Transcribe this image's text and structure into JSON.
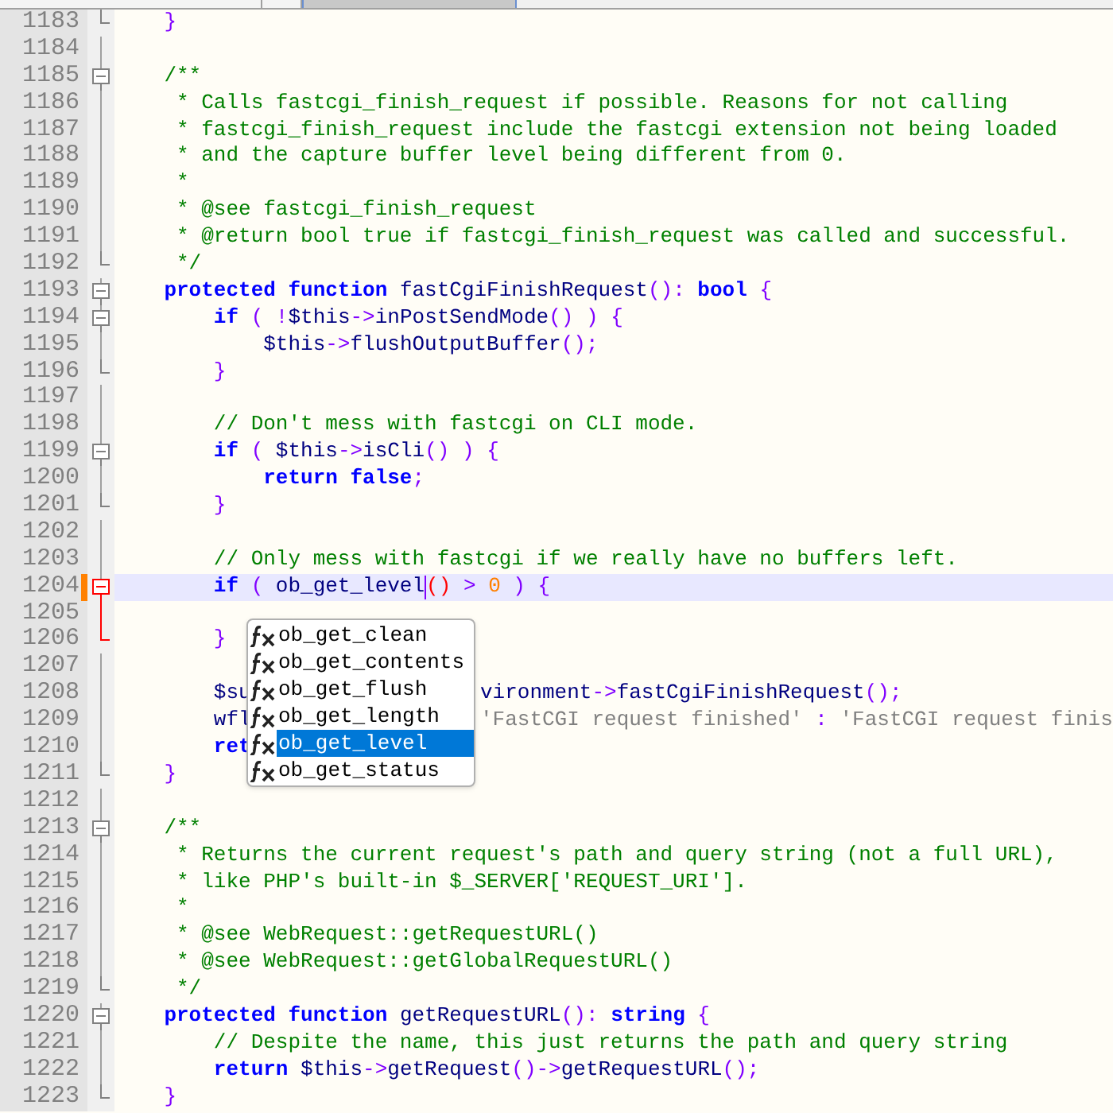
{
  "tabs": [
    {
      "selected": false
    },
    {
      "selected": false
    },
    {
      "selected": true
    }
  ],
  "editor": {
    "lines": [
      {
        "number": "1183",
        "kind": "end",
        "tokens": [
          {
            "kind": "op",
            "text": "    }"
          }
        ]
      },
      {
        "number": "1184",
        "kind": "line"
      },
      {
        "number": "1185",
        "kind": "box",
        "tokens": [
          {
            "kind": "cm",
            "text": "    /**"
          }
        ]
      },
      {
        "number": "1186",
        "kind": "line",
        "tokens": [
          {
            "kind": "cm",
            "text": "     * Calls fastcgi_finish_request if possible. Reasons for not calling"
          }
        ]
      },
      {
        "number": "1187",
        "kind": "line",
        "tokens": [
          {
            "kind": "cm",
            "text": "     * fastcgi_finish_request include the fastcgi extension not being loaded"
          }
        ]
      },
      {
        "number": "1188",
        "kind": "line",
        "tokens": [
          {
            "kind": "cm",
            "text": "     * and the capture buffer level being different from 0."
          }
        ]
      },
      {
        "number": "1189",
        "kind": "line",
        "tokens": [
          {
            "kind": "cm",
            "text": "     *"
          }
        ]
      },
      {
        "number": "1190",
        "kind": "line",
        "tokens": [
          {
            "kind": "cm",
            "text": "     * @see fastcgi_finish_request"
          }
        ]
      },
      {
        "number": "1191",
        "kind": "line",
        "tokens": [
          {
            "kind": "cm",
            "text": "     * @return bool true if fastcgi_finish_request was called and successful."
          }
        ]
      },
      {
        "number": "1192",
        "kind": "end",
        "tokens": [
          {
            "kind": "cm",
            "text": "     */"
          }
        ]
      },
      {
        "number": "1193",
        "kind": "box",
        "tokens": [
          {
            "kind": "kw",
            "text": "    protected"
          },
          {
            "kind": "kw",
            "text": " function"
          },
          {
            "kind": "id",
            "text": " fastCgiFinishRequest"
          },
          {
            "kind": "op",
            "text": "():"
          },
          {
            "kind": "kw",
            "text": " bool"
          },
          {
            "kind": "op",
            "text": " {"
          }
        ]
      },
      {
        "number": "1194",
        "kind": "box",
        "tokens": [
          {
            "kind": "kw",
            "text": "        if"
          },
          {
            "kind": "op",
            "text": " ( !"
          },
          {
            "kind": "id",
            "text": "$this"
          },
          {
            "kind": "op",
            "text": "->"
          },
          {
            "kind": "id",
            "text": "inPostSendMode"
          },
          {
            "kind": "op",
            "text": "() ) {"
          }
        ]
      },
      {
        "number": "1195",
        "kind": "line",
        "tokens": [
          {
            "kind": "id",
            "text": "            $this"
          },
          {
            "kind": "op",
            "text": "->"
          },
          {
            "kind": "id",
            "text": "flushOutputBuffer"
          },
          {
            "kind": "op",
            "text": "();"
          }
        ]
      },
      {
        "number": "1196",
        "kind": "end",
        "tokens": [
          {
            "kind": "op",
            "text": "        }"
          }
        ]
      },
      {
        "number": "1197",
        "kind": "line"
      },
      {
        "number": "1198",
        "kind": "line",
        "tokens": [
          {
            "kind": "cm",
            "text": "        // Don't mess with fastcgi on CLI mode."
          }
        ]
      },
      {
        "number": "1199",
        "kind": "box",
        "tokens": [
          {
            "kind": "kw",
            "text": "        if"
          },
          {
            "kind": "op",
            "text": " ( "
          },
          {
            "kind": "id",
            "text": "$this"
          },
          {
            "kind": "op",
            "text": "->"
          },
          {
            "kind": "id",
            "text": "isCli"
          },
          {
            "kind": "op",
            "text": "() ) {"
          }
        ]
      },
      {
        "number": "1200",
        "kind": "line",
        "tokens": [
          {
            "kind": "kw",
            "text": "            return false"
          },
          {
            "kind": "op",
            "text": ";"
          }
        ]
      },
      {
        "number": "1201",
        "kind": "end",
        "tokens": [
          {
            "kind": "op",
            "text": "        }"
          }
        ]
      },
      {
        "number": "1202",
        "kind": "line"
      },
      {
        "number": "1203",
        "kind": "line",
        "tokens": [
          {
            "kind": "cm",
            "text": "        // Only mess with fastcgi if we really have no buffers left."
          }
        ]
      },
      {
        "number": "1204",
        "kind": "box",
        "active": true,
        "current": true,
        "changed": true,
        "tokens": [
          {
            "kind": "kw",
            "text": "        if"
          },
          {
            "kind": "op",
            "text": " ( "
          },
          {
            "kind": "id",
            "text": "ob_get_level",
            "caret": true
          },
          {
            "kind": "match",
            "text": "()"
          },
          {
            "kind": "op",
            "text": " > "
          },
          {
            "kind": "num",
            "text": "0"
          },
          {
            "kind": "op",
            "text": " ) {"
          }
        ]
      },
      {
        "number": "1205",
        "kind": "line",
        "active": true
      },
      {
        "number": "1206",
        "kind": "end",
        "active": true,
        "tokens": [
          {
            "kind": "op",
            "text": "        }"
          }
        ]
      },
      {
        "number": "1207",
        "kind": "line"
      },
      {
        "number": "1208",
        "kind": "line",
        "tokens": [
          {
            "kind": "id",
            "text": "        $su"
          }
        ],
        "tokens_right": [
          {
            "kind": "id",
            "text": "vironment"
          },
          {
            "kind": "op",
            "text": "->"
          },
          {
            "kind": "id",
            "text": "fastCgiFinishRequest"
          },
          {
            "kind": "op",
            "text": "();"
          }
        ]
      },
      {
        "number": "1209",
        "kind": "line",
        "tokens": [
          {
            "kind": "id",
            "text": "        wfl"
          }
        ],
        "tokens_right": [
          {
            "kind": "str",
            "text": "'FastCGI request finished'"
          },
          {
            "kind": "op",
            "text": " : "
          },
          {
            "kind": "str",
            "text": "'FastCGI request finis"
          }
        ]
      },
      {
        "number": "1210",
        "kind": "line",
        "tokens": [
          {
            "kind": "kw",
            "text": "        ret"
          }
        ]
      },
      {
        "number": "1211",
        "kind": "end",
        "tokens": [
          {
            "kind": "op",
            "text": "    }"
          }
        ]
      },
      {
        "number": "1212",
        "kind": "line"
      },
      {
        "number": "1213",
        "kind": "box",
        "tokens": [
          {
            "kind": "cm",
            "text": "    /**"
          }
        ]
      },
      {
        "number": "1214",
        "kind": "line",
        "tokens": [
          {
            "kind": "cm",
            "text": "     * Returns the current request's path and query string (not a full URL),"
          }
        ]
      },
      {
        "number": "1215",
        "kind": "line",
        "tokens": [
          {
            "kind": "cm",
            "text": "     * like PHP's built-in $_SERVER['REQUEST_URI']."
          }
        ]
      },
      {
        "number": "1216",
        "kind": "line",
        "tokens": [
          {
            "kind": "cm",
            "text": "     *"
          }
        ]
      },
      {
        "number": "1217",
        "kind": "line",
        "tokens": [
          {
            "kind": "cm",
            "text": "     * @see WebRequest::getRequestURL()"
          }
        ]
      },
      {
        "number": "1218",
        "kind": "line",
        "tokens": [
          {
            "kind": "cm",
            "text": "     * @see WebRequest::getGlobalRequestURL()"
          }
        ]
      },
      {
        "number": "1219",
        "kind": "end",
        "tokens": [
          {
            "kind": "cm",
            "text": "     */"
          }
        ]
      },
      {
        "number": "1220",
        "kind": "box",
        "tokens": [
          {
            "kind": "kw",
            "text": "    protected"
          },
          {
            "kind": "kw",
            "text": " function"
          },
          {
            "kind": "id",
            "text": " getRequestURL"
          },
          {
            "kind": "op",
            "text": "():"
          },
          {
            "kind": "kw",
            "text": " string"
          },
          {
            "kind": "op",
            "text": " {"
          }
        ]
      },
      {
        "number": "1221",
        "kind": "line",
        "tokens": [
          {
            "kind": "cm",
            "text": "        // Despite the name, this just returns the path and query string"
          }
        ]
      },
      {
        "number": "1222",
        "kind": "line",
        "tokens": [
          {
            "kind": "kw",
            "text": "        return"
          },
          {
            "kind": "id",
            "text": " $this"
          },
          {
            "kind": "op",
            "text": "->"
          },
          {
            "kind": "id",
            "text": "getRequest"
          },
          {
            "kind": "op",
            "text": "()->"
          },
          {
            "kind": "id",
            "text": "getRequestURL"
          },
          {
            "kind": "op",
            "text": "();"
          }
        ]
      },
      {
        "number": "1223",
        "kind": "end",
        "tokens": [
          {
            "kind": "op",
            "text": "    }"
          }
        ]
      }
    ]
  },
  "autocomplete": {
    "items": [
      {
        "text": "ob_get_clean",
        "selected": false
      },
      {
        "text": "ob_get_contents",
        "selected": false
      },
      {
        "text": "ob_get_flush",
        "selected": false
      },
      {
        "text": "ob_get_length",
        "selected": false
      },
      {
        "text": "ob_get_level",
        "selected": true
      },
      {
        "text": "ob_get_status",
        "selected": false
      }
    ]
  }
}
